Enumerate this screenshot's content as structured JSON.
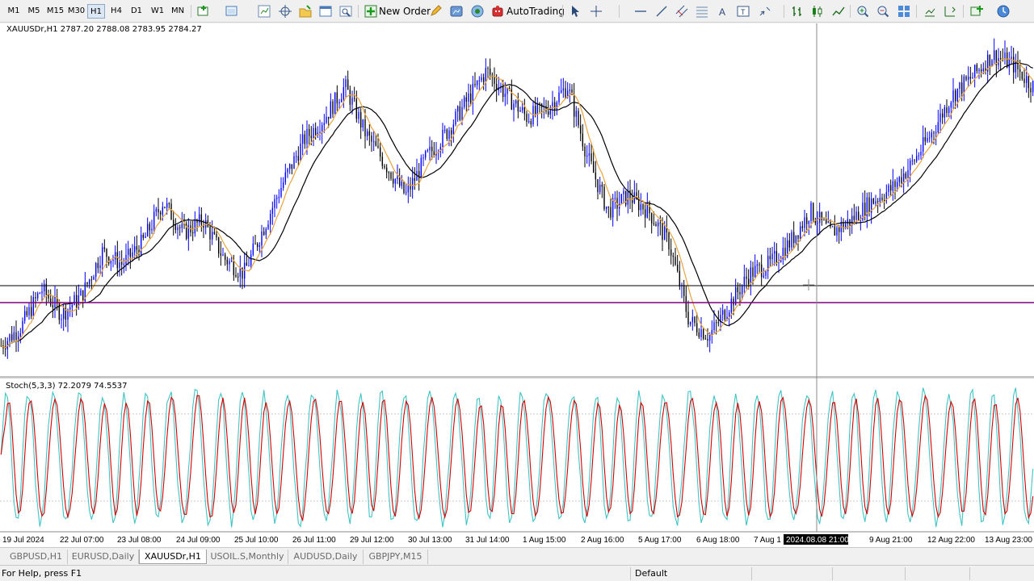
{
  "toolbar": {
    "timeframes": [
      "M1",
      "M5",
      "M15",
      "M30",
      "H1",
      "H4",
      "D1",
      "W1",
      "MN"
    ],
    "active_timeframe": "H1",
    "new_order_label": "New Order",
    "autotrading_label": "AutoTrading"
  },
  "chart": {
    "info_label": "XAUUSDr,H1  2787.20 2788.08 2783.95 2784.27",
    "stoch_label": "Stoch(5,3,3) 72.2079 74.5537",
    "time_labels": [
      "19 Jul 2024",
      "22 Jul 07:00",
      "23 Jul 08:00",
      "24 Jul 09:00",
      "25 Jul 10:00",
      "26 Jul 11:00",
      "29 Jul 12:00",
      "30 Jul 13:00",
      "31 Jul 14:00",
      "1 Aug 15:00",
      "2 Aug 16:00",
      "5 Aug 17:00",
      "6 Aug 18:00",
      "7 Aug 1",
      "9 Aug 21:00",
      "12 Aug 22:00",
      "13 Aug 23:00"
    ],
    "crosshair_time": "2024.08.08 21:00",
    "colors": {
      "bull_candle": "#0000ff",
      "bear_candle": "#000000",
      "fast_ma": "#e8a33d",
      "slow_ma": "#000000",
      "stoch_main": "#40c4c4",
      "stoch_signal": "#d40000",
      "hline_dark": "#000000",
      "hline_purple": "#800080"
    }
  },
  "chart_data": {
    "type": "line",
    "symbol": "XAUUSDr",
    "timeframe": "H1",
    "ohlc_last": {
      "open": 2787.2,
      "high": 2788.08,
      "low": 2783.95,
      "close": 2784.27
    },
    "price_path": [
      0.12,
      0.18,
      0.3,
      0.22,
      0.28,
      0.42,
      0.38,
      0.45,
      0.58,
      0.48,
      0.52,
      0.4,
      0.35,
      0.5,
      0.65,
      0.78,
      0.85,
      0.95,
      0.8,
      0.7,
      0.6,
      0.72,
      0.8,
      0.9,
      1.0,
      0.92,
      0.85,
      0.88,
      0.95,
      0.72,
      0.55,
      0.6,
      0.55,
      0.45,
      0.2,
      0.15,
      0.25,
      0.35,
      0.38,
      0.45,
      0.55,
      0.48,
      0.52,
      0.58,
      0.62,
      0.7,
      0.8,
      0.92,
      0.98,
      1.05,
      1.02,
      0.95
    ],
    "stoch_cycles": 44,
    "stoch_last": {
      "main": 72.2079,
      "signal": 74.5537
    },
    "stoch_levels": [
      80,
      20
    ]
  },
  "tabs": [
    "GBPUSD,H1",
    "EURUSD,Daily",
    "XAUUSDr,H1",
    "USOIL.S,Monthly",
    "AUDUSD,Daily",
    "GBPJPY,M15"
  ],
  "active_tab": "XAUUSDr,H1",
  "status": {
    "help": "For Help, press F1",
    "profile": "Default"
  }
}
